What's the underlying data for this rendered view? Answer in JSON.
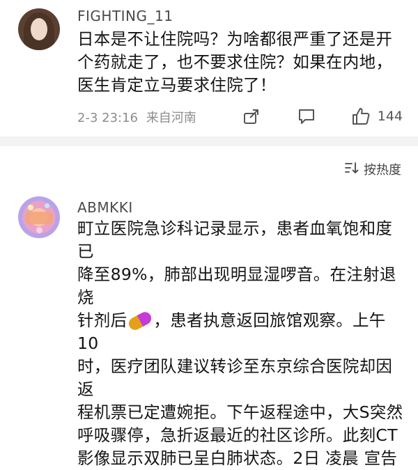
{
  "comments": [
    {
      "username": "FIGHTING_11",
      "lines": [
        "日本是不让住院吗？为啥都很严重了还是开",
        "个药就走了，也不要求住院？如果在内地，",
        "医生肯定立马要求住院了！"
      ],
      "date": "2-3 23:16",
      "location": "来自河南",
      "likes": "144",
      "icons": [
        "share-icon",
        "comment-icon",
        "like-icon"
      ]
    },
    {
      "username": "ABMKKI",
      "lines": [
        "町立医院急诊科记录显示，患者血氧饱和度已",
        "降至89%，肺部出现明显湿啰音。在注射退烧",
        "针剂后",
        "，患者执意返回旅馆观察。上午10",
        "时，医疗团队建议转诊至东京综合医院却因返",
        "程机票已定遭婉拒。下午返程途中，大S突然",
        "呼吸骤停，急折返最近的社区诊所。此刻CT",
        "影像显示双肺已呈白肺状态。2日 凌晨 宣告"
      ],
      "emoji": "pill-emoji"
    }
  ],
  "sort": {
    "label": "按热度",
    "icon": "sort-icon"
  }
}
